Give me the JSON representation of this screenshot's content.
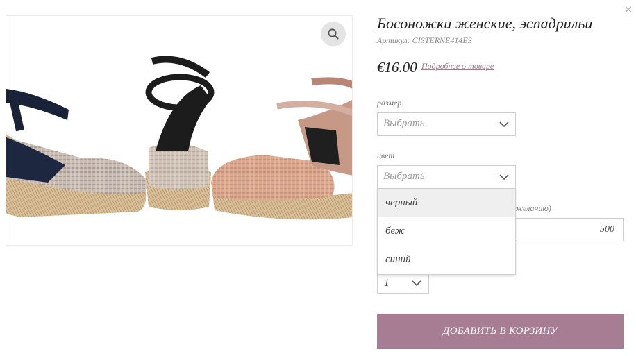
{
  "modal": {
    "close_icon": "close-icon",
    "close_glyph": "✕"
  },
  "product": {
    "title": "Босоножки женские, эспадрильи",
    "sku": "Артикул: CISTERNE414ES",
    "price": "€16.00",
    "details_link": "Подробнее о товаре",
    "image_icon": "zoom-icon"
  },
  "size_field": {
    "label": "размер",
    "value": "Выбрать"
  },
  "color_field": {
    "label": "цвет",
    "value": "Выбрать",
    "options": [
      "черный",
      "беж",
      "синий"
    ],
    "highlighted_index": 0
  },
  "custom_field": {
    "label_partial": "желанию)",
    "value": "500"
  },
  "quantity": {
    "value": "1"
  },
  "cart_button": {
    "label": "ДОБАВИТЬ В КОРЗИНУ"
  },
  "colors": {
    "accent": "#a67d92",
    "link": "#9a7a8a",
    "border": "#cfcfcf"
  }
}
